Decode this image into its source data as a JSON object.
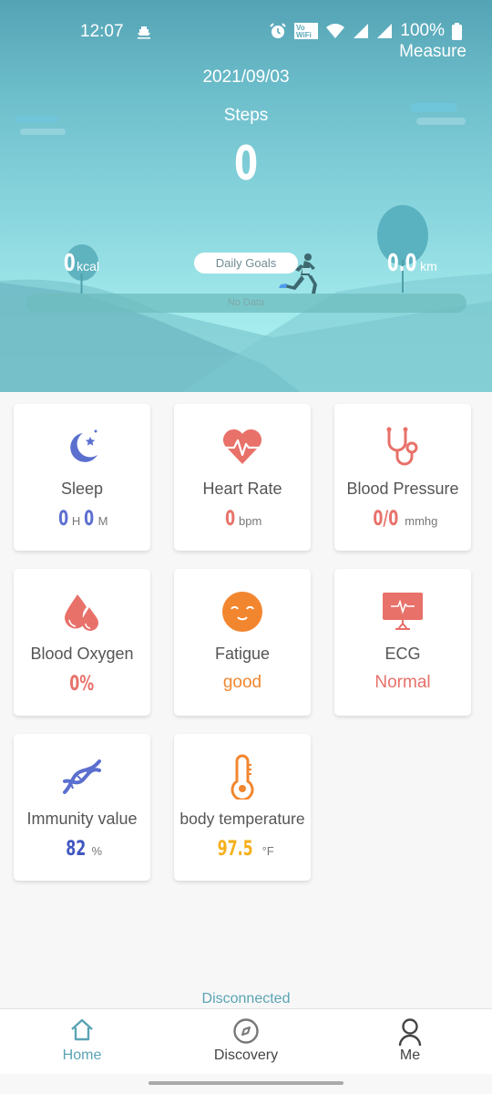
{
  "status_bar": {
    "time": "12:07",
    "battery": "100%",
    "icons": [
      "boat-icon",
      "alarm-icon",
      "vowifi-icon",
      "wifi-icon",
      "signal-icon",
      "signal-icon",
      "battery-icon"
    ]
  },
  "header": {
    "measure_label": "Measure",
    "date": "2021/09/03",
    "steps_label": "Steps",
    "steps_value": "0",
    "calories_value": "0",
    "calories_unit": "kcal",
    "distance_value": "0.0",
    "distance_unit": "km",
    "daily_goals_label": "Daily Goals",
    "progress_text": "No Data",
    "progress": 0
  },
  "cards": {
    "sleep": {
      "label": "Sleep",
      "hours": "0",
      "hours_unit": "H",
      "minutes": "0",
      "minutes_unit": "M",
      "icon": "moon-star-icon"
    },
    "heart_rate": {
      "label": "Heart Rate",
      "value": "0",
      "unit": "bpm",
      "icon": "heart-pulse-icon"
    },
    "blood_pressure": {
      "label": "Blood Pressure",
      "value": "0/0",
      "unit": "mmhg",
      "icon": "stethoscope-icon"
    },
    "blood_oxygen": {
      "label": "Blood Oxygen",
      "value": "0%",
      "icon": "drops-icon"
    },
    "fatigue": {
      "label": "Fatigue",
      "value": "good",
      "icon": "smiley-icon"
    },
    "ecg": {
      "label": "ECG",
      "value": "Normal",
      "icon": "monitor-ecg-icon"
    },
    "immunity": {
      "label": "Immunity value",
      "value": "82",
      "unit": "%",
      "icon": "dna-icon"
    },
    "temperature": {
      "label": "body temperature",
      "value": "97.5",
      "unit": "°F",
      "icon": "thermometer-icon"
    }
  },
  "colors": {
    "blue": "#5b6fcf",
    "red": "#e8716a",
    "orange": "#f2862f",
    "amber": "#f5b01c",
    "teal": "#5aa4b4"
  },
  "connection_status": "Disconnected",
  "nav": {
    "items": [
      {
        "label": "Home",
        "icon": "home-icon",
        "active": true
      },
      {
        "label": "Discovery",
        "icon": "compass-icon",
        "active": false
      },
      {
        "label": "Me",
        "icon": "person-icon",
        "active": false
      }
    ]
  }
}
